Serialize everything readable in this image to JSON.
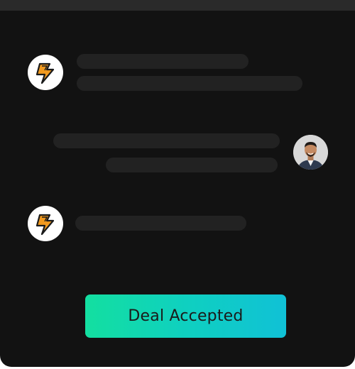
{
  "colors": {
    "panel_bg": "#121212",
    "top_bar": "#2a2a2a",
    "placeholder_bar": "#222222",
    "cta_gradient_start": "#13dfa0",
    "cta_gradient_end": "#10c1d6",
    "brand_orange": "#f29a1f"
  },
  "messages": [
    {
      "sender": "brand",
      "avatar_icon": "brand-lightning-logo-icon",
      "placeholder_lines": 2
    },
    {
      "sender": "user",
      "avatar_icon": "user-photo-avatar",
      "placeholder_lines": 2
    },
    {
      "sender": "brand",
      "avatar_icon": "brand-lightning-logo-icon",
      "placeholder_lines": 1
    }
  ],
  "cta": {
    "label": "Deal Accepted"
  }
}
